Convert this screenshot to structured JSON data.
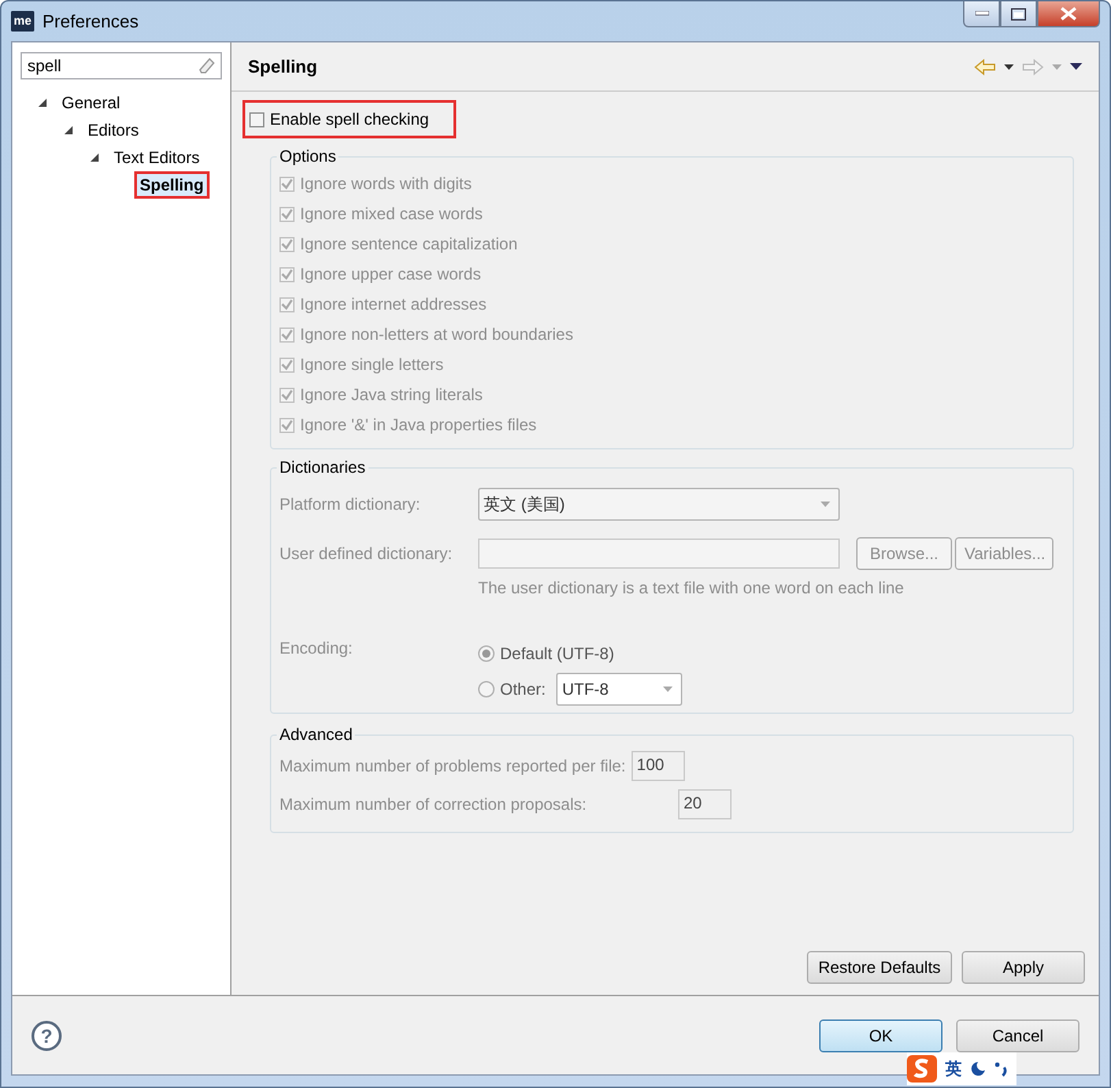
{
  "window": {
    "title": "Preferences",
    "logo": "me"
  },
  "filter": {
    "value": "spell"
  },
  "tree": [
    {
      "label": "General",
      "expanded": true,
      "selected": false,
      "highlighted": false,
      "children": [
        {
          "label": "Editors",
          "expanded": true,
          "selected": false,
          "highlighted": false,
          "children": [
            {
              "label": "Text Editors",
              "expanded": true,
              "selected": false,
              "highlighted": false,
              "children": [
                {
                  "label": "Spelling",
                  "selected": true,
                  "highlighted": true
                }
              ]
            }
          ]
        }
      ]
    }
  ],
  "page": {
    "title": "Spelling"
  },
  "enable": {
    "label": "Enable spell checking",
    "checked": false,
    "highlighted": true
  },
  "options": {
    "title": "Options",
    "items": [
      {
        "label": "Ignore words with digits",
        "checked": true,
        "disabled": true
      },
      {
        "label": "Ignore mixed case words",
        "checked": true,
        "disabled": true
      },
      {
        "label": "Ignore sentence capitalization",
        "checked": true,
        "disabled": true
      },
      {
        "label": "Ignore upper case words",
        "checked": true,
        "disabled": true
      },
      {
        "label": "Ignore internet addresses",
        "checked": true,
        "disabled": true
      },
      {
        "label": "Ignore non-letters at word boundaries",
        "checked": true,
        "disabled": true
      },
      {
        "label": "Ignore single letters",
        "checked": true,
        "disabled": true
      },
      {
        "label": "Ignore Java string literals",
        "checked": true,
        "disabled": true
      },
      {
        "label": "Ignore '&' in Java properties files",
        "checked": true,
        "disabled": true
      }
    ]
  },
  "dictionaries": {
    "title": "Dictionaries",
    "platform_label": "Platform dictionary:",
    "platform_value": "英文 (美国)",
    "user_label": "User defined dictionary:",
    "browse": "Browse...",
    "variables": "Variables...",
    "hint": "The user dictionary is a text file with one word on each line",
    "encoding_label": "Encoding:",
    "encodings": [
      {
        "label": "Default (UTF-8)",
        "selected": true
      },
      {
        "label": "Other:",
        "selected": false
      }
    ],
    "other_value": "UTF-8"
  },
  "advanced": {
    "title": "Advanced",
    "fields": [
      {
        "label": "Maximum number of problems reported per file:",
        "value": "100"
      },
      {
        "label": "Maximum number of correction proposals:",
        "value": "20"
      }
    ]
  },
  "page_buttons": [
    "Restore Defaults",
    "Apply"
  ],
  "dialog_buttons": [
    {
      "label": "OK",
      "default": true
    },
    {
      "label": "Cancel",
      "default": false
    }
  ],
  "help": {
    "label": "?"
  },
  "ime_bar": {
    "text": "英"
  }
}
